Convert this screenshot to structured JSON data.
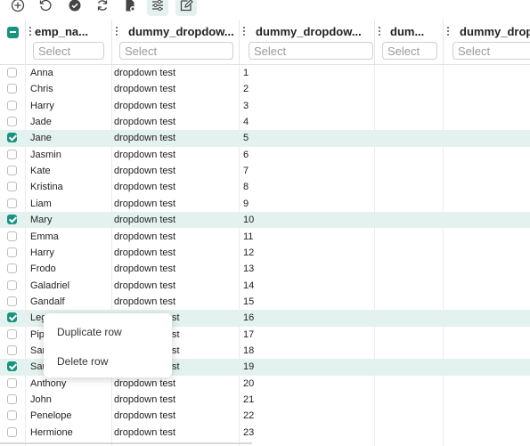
{
  "columns": [
    {
      "label": "emp_na...",
      "placeholder": "Select"
    },
    {
      "label": "dummy_dropdow...",
      "placeholder": "Select"
    },
    {
      "label": "dummy_dropdow...",
      "placeholder": "Select"
    },
    {
      "label": "dum...",
      "placeholder": "Select"
    },
    {
      "label": "dummy_dropd",
      "placeholder": "Select"
    }
  ],
  "rows": [
    {
      "name": "Anna",
      "dd": "dropdown test",
      "num": "1",
      "selected": false
    },
    {
      "name": "Chris",
      "dd": "dropdown test",
      "num": "2",
      "selected": false
    },
    {
      "name": "Harry",
      "dd": "dropdown test",
      "num": "3",
      "selected": false
    },
    {
      "name": "Jade",
      "dd": "dropdown test",
      "num": "4",
      "selected": false
    },
    {
      "name": "Jane",
      "dd": "dropdown test",
      "num": "5",
      "selected": true
    },
    {
      "name": "Jasmin",
      "dd": "dropdown test",
      "num": "6",
      "selected": false
    },
    {
      "name": "Kate",
      "dd": "dropdown test",
      "num": "7",
      "selected": false
    },
    {
      "name": "Kristina",
      "dd": "dropdown test",
      "num": "8",
      "selected": false
    },
    {
      "name": "Liam",
      "dd": "dropdown test",
      "num": "9",
      "selected": false
    },
    {
      "name": "Mary",
      "dd": "dropdown test",
      "num": "10",
      "selected": true
    },
    {
      "name": "Emma",
      "dd": "dropdown test",
      "num": "11",
      "selected": false
    },
    {
      "name": "Harry",
      "dd": "dropdown test",
      "num": "12",
      "selected": false
    },
    {
      "name": "Frodo",
      "dd": "dropdown test",
      "num": "13",
      "selected": false
    },
    {
      "name": "Galadriel",
      "dd": "dropdown test",
      "num": "14",
      "selected": false
    },
    {
      "name": "Gandalf",
      "dd": "dropdown test",
      "num": "15",
      "selected": false
    },
    {
      "name": "Leg",
      "dd": "st",
      "num": "16",
      "selected": true
    },
    {
      "name": "Pip",
      "dd": "st",
      "num": "17",
      "selected": false
    },
    {
      "name": "Sar",
      "dd": "st",
      "num": "18",
      "selected": false
    },
    {
      "name": "Sau",
      "dd": "st",
      "num": "19",
      "selected": true
    },
    {
      "name": "Anthony",
      "dd": "dropdown test",
      "num": "20",
      "selected": false
    },
    {
      "name": "John",
      "dd": "dropdown test",
      "num": "21",
      "selected": false
    },
    {
      "name": "Penelope",
      "dd": "dropdown test",
      "num": "22",
      "selected": false
    },
    {
      "name": "Hermione",
      "dd": "dropdown test",
      "num": "23",
      "selected": false
    }
  ],
  "context_menu": {
    "duplicate": "Duplicate row",
    "delete": "Delete row"
  },
  "toolbar_icons": [
    "add-icon",
    "undo-icon",
    "check-circle-icon",
    "refresh-icon",
    "delete-file-icon",
    "filter-settings-icon",
    "edit-icon"
  ],
  "colors": {
    "accent": "#17937f",
    "selected_row": "#e4f2ef"
  }
}
